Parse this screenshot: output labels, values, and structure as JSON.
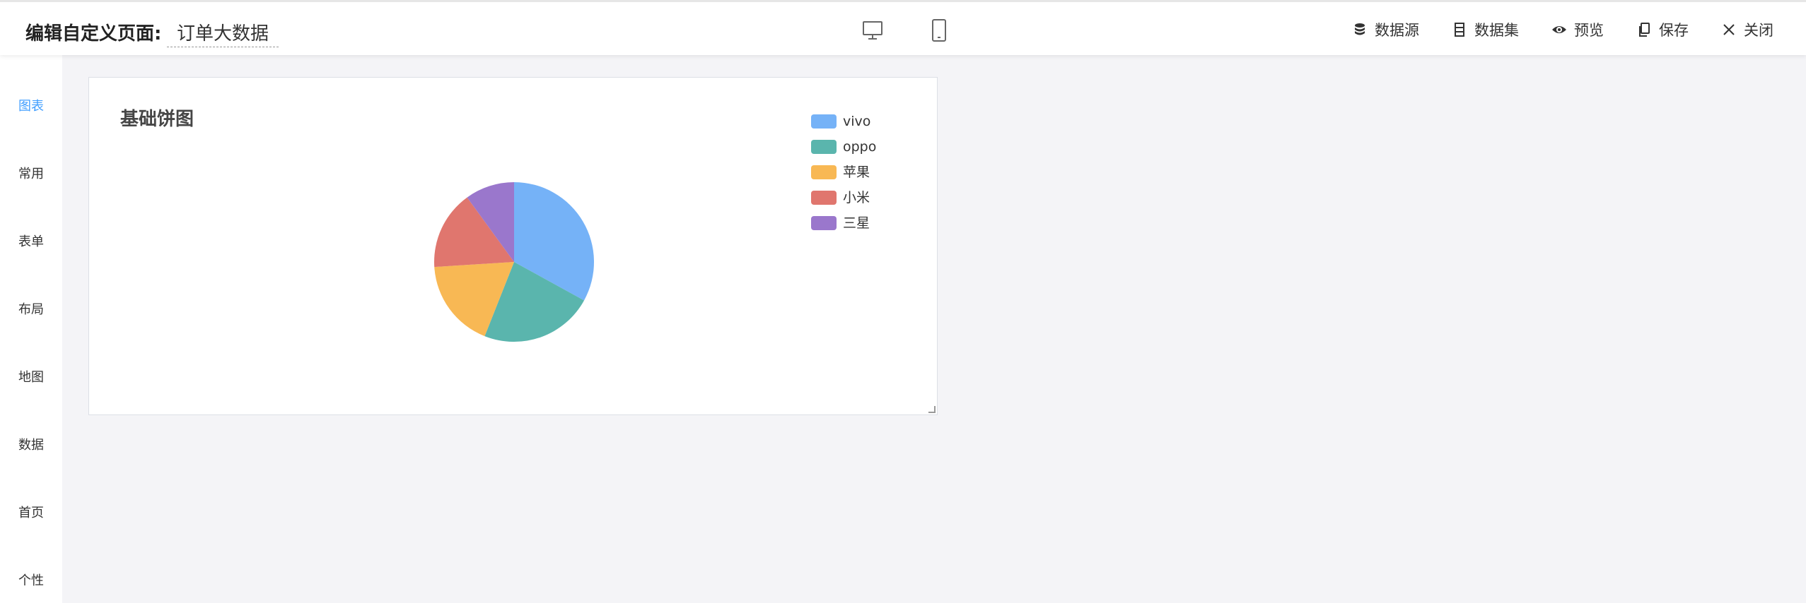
{
  "header": {
    "title": "编辑自定义页面:",
    "page_name": "订单大数据",
    "devices": [
      {
        "name": "desktop",
        "icon": "monitor-icon"
      },
      {
        "name": "mobile",
        "icon": "mobile-icon"
      }
    ],
    "toolbar": [
      {
        "label": "数据源",
        "icon": "database-icon"
      },
      {
        "label": "数据集",
        "icon": "dataset-icon"
      },
      {
        "label": "预览",
        "icon": "eye-icon"
      },
      {
        "label": "保存",
        "icon": "copy-icon"
      },
      {
        "label": "关闭",
        "icon": "close-icon"
      }
    ]
  },
  "sidebar": {
    "items": [
      {
        "label": "图表",
        "icon": "bar-chart-icon",
        "active": true
      },
      {
        "label": "常用",
        "icon": "gear-icon",
        "active": false
      },
      {
        "label": "表单",
        "icon": "form-icon",
        "active": false
      },
      {
        "label": "布局",
        "icon": "folder-icon",
        "active": false
      },
      {
        "label": "地图",
        "icon": "grid-icon",
        "active": false
      },
      {
        "label": "数据",
        "icon": "table-icon",
        "active": false
      },
      {
        "label": "首页",
        "icon": "home-icon",
        "active": false
      },
      {
        "label": "个性",
        "icon": "apps-icon",
        "active": false
      }
    ],
    "active_color": "#409eff"
  },
  "chart_data": {
    "type": "pie",
    "title": "基础饼图",
    "legend_position": "top-right",
    "categories": [
      "vivo",
      "oppo",
      "苹果",
      "小米",
      "三星"
    ],
    "values": [
      33,
      23,
      18,
      16,
      10
    ],
    "colors": [
      "#75b2f7",
      "#5ab5ad",
      "#f8b854",
      "#e0766e",
      "#9a77cc"
    ]
  }
}
